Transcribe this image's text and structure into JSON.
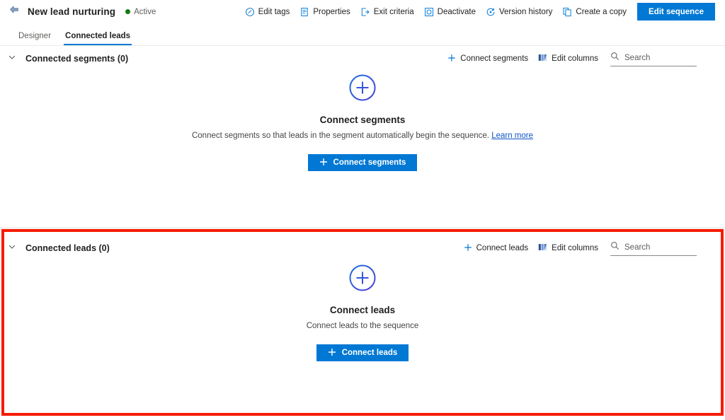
{
  "header": {
    "back_icon": "back-arrow-icon",
    "title": "New lead nurturing",
    "status_label": "Active",
    "status_color": "#107c10",
    "commands": [
      {
        "icon": "edit-tags-icon",
        "label": "Edit tags"
      },
      {
        "icon": "properties-icon",
        "label": "Properties"
      },
      {
        "icon": "exit-criteria-icon",
        "label": "Exit criteria"
      },
      {
        "icon": "deactivate-icon",
        "label": "Deactivate"
      },
      {
        "icon": "version-history-icon",
        "label": "Version history"
      },
      {
        "icon": "create-a-copy-icon",
        "label": "Create a copy"
      }
    ],
    "primary_button": "Edit sequence"
  },
  "tabs": [
    {
      "label": "Designer",
      "active": false
    },
    {
      "label": "Connected leads",
      "active": true
    }
  ],
  "sections": [
    {
      "id": "connected-segments",
      "title": "Connected segments (0)",
      "chevron_icon": "chevron-down-icon",
      "actions": {
        "add_icon": "plus-icon",
        "add_label": "Connect segments",
        "edit_columns_icon": "edit-columns-icon",
        "edit_columns_label": "Edit columns",
        "search_icon": "search-icon",
        "search_placeholder": "Search",
        "search_value": ""
      },
      "empty": {
        "icon": "plus-circle-icon",
        "title": "Connect segments",
        "description": "Connect segments so that leads in the segment automatically begin the sequence.",
        "link_text": "Learn more",
        "button_icon": "plus-icon",
        "button_label": "Connect segments"
      }
    },
    {
      "id": "connected-leads",
      "title": "Connected leads (0)",
      "chevron_icon": "chevron-down-icon",
      "actions": {
        "add_icon": "plus-icon",
        "add_label": "Connect leads",
        "edit_columns_icon": "edit-columns-icon",
        "edit_columns_label": "Edit columns",
        "search_icon": "search-icon",
        "search_placeholder": "Search",
        "search_value": ""
      },
      "empty": {
        "icon": "plus-circle-icon",
        "title": "Connect leads",
        "description": "Connect leads to the sequence",
        "link_text": "",
        "button_icon": "plus-icon",
        "button_label": "Connect leads"
      }
    }
  ],
  "highlight": {
    "color": "#f61a00"
  },
  "colors": {
    "accent": "#0078d4",
    "link": "#0f54c4",
    "text": "#201f1e",
    "subtle": "#605e5c",
    "highlight": "#f61a00",
    "status_active": "#107c10"
  }
}
